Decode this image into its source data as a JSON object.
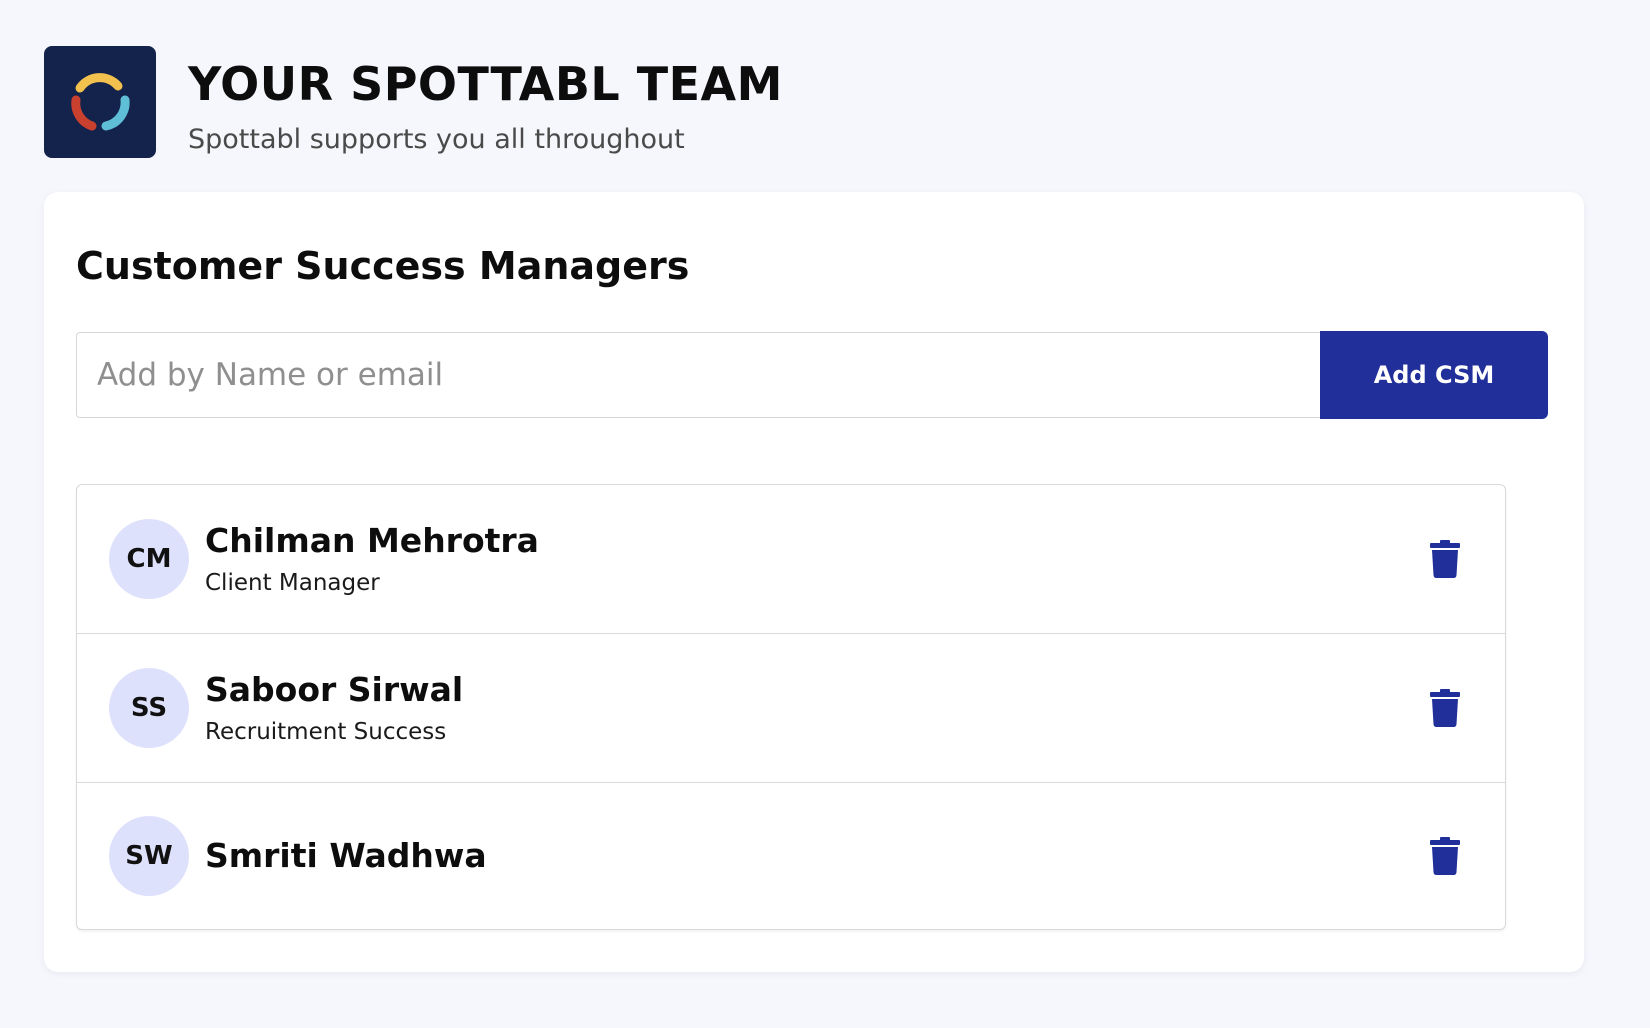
{
  "header": {
    "title": "YOUR SPOTTABL TEAM",
    "subtitle": "Spottabl supports you all throughout",
    "logo_icon": "spottabl-ring-logo-icon"
  },
  "card": {
    "title": "Customer Success Managers",
    "search": {
      "placeholder": "Add by Name or email",
      "value": ""
    },
    "add_button_label": "Add CSM",
    "managers": [
      {
        "initials": "CM",
        "name": "Chilman Mehrotra",
        "role": "Client Manager"
      },
      {
        "initials": "SS",
        "name": "Saboor Sirwal",
        "role": "Recruitment Success"
      },
      {
        "initials": "SW",
        "name": "Smriti Wadhwa",
        "role": ""
      }
    ],
    "delete_icon": "trash-icon"
  },
  "colors": {
    "page_background": "#f6f7fc",
    "logo_background": "#14234b",
    "accent": "#212f9b",
    "avatar_background": "#dee1fb",
    "logo_ring_yellow": "#f2c14e",
    "logo_ring_blue": "#5fbfd6",
    "logo_ring_red": "#c9402f"
  }
}
